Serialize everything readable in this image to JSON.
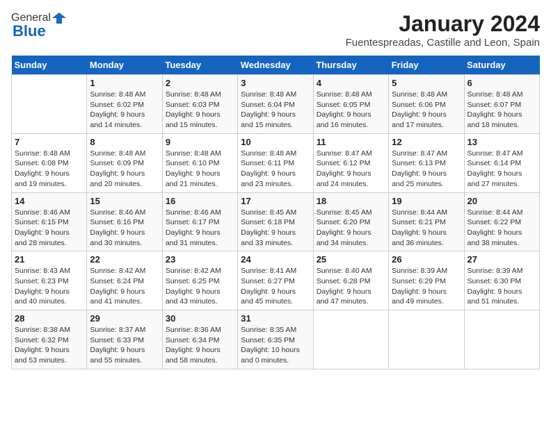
{
  "logo": {
    "general": "General",
    "blue": "Blue"
  },
  "title": "January 2024",
  "subtitle": "Fuentespreadas, Castille and Leon, Spain",
  "days_header": [
    "Sunday",
    "Monday",
    "Tuesday",
    "Wednesday",
    "Thursday",
    "Friday",
    "Saturday"
  ],
  "weeks": [
    [
      {
        "num": "",
        "info": ""
      },
      {
        "num": "1",
        "info": "Sunrise: 8:48 AM\nSunset: 6:02 PM\nDaylight: 9 hours\nand 14 minutes."
      },
      {
        "num": "2",
        "info": "Sunrise: 8:48 AM\nSunset: 6:03 PM\nDaylight: 9 hours\nand 15 minutes."
      },
      {
        "num": "3",
        "info": "Sunrise: 8:48 AM\nSunset: 6:04 PM\nDaylight: 9 hours\nand 15 minutes."
      },
      {
        "num": "4",
        "info": "Sunrise: 8:48 AM\nSunset: 6:05 PM\nDaylight: 9 hours\nand 16 minutes."
      },
      {
        "num": "5",
        "info": "Sunrise: 8:48 AM\nSunset: 6:06 PM\nDaylight: 9 hours\nand 17 minutes."
      },
      {
        "num": "6",
        "info": "Sunrise: 8:48 AM\nSunset: 6:07 PM\nDaylight: 9 hours\nand 18 minutes."
      }
    ],
    [
      {
        "num": "7",
        "info": "Sunrise: 8:48 AM\nSunset: 6:08 PM\nDaylight: 9 hours\nand 19 minutes."
      },
      {
        "num": "8",
        "info": "Sunrise: 8:48 AM\nSunset: 6:09 PM\nDaylight: 9 hours\nand 20 minutes."
      },
      {
        "num": "9",
        "info": "Sunrise: 8:48 AM\nSunset: 6:10 PM\nDaylight: 9 hours\nand 21 minutes."
      },
      {
        "num": "10",
        "info": "Sunrise: 8:48 AM\nSunset: 6:11 PM\nDaylight: 9 hours\nand 23 minutes."
      },
      {
        "num": "11",
        "info": "Sunrise: 8:47 AM\nSunset: 6:12 PM\nDaylight: 9 hours\nand 24 minutes."
      },
      {
        "num": "12",
        "info": "Sunrise: 8:47 AM\nSunset: 6:13 PM\nDaylight: 9 hours\nand 25 minutes."
      },
      {
        "num": "13",
        "info": "Sunrise: 8:47 AM\nSunset: 6:14 PM\nDaylight: 9 hours\nand 27 minutes."
      }
    ],
    [
      {
        "num": "14",
        "info": "Sunrise: 8:46 AM\nSunset: 6:15 PM\nDaylight: 9 hours\nand 28 minutes."
      },
      {
        "num": "15",
        "info": "Sunrise: 8:46 AM\nSunset: 6:16 PM\nDaylight: 9 hours\nand 30 minutes."
      },
      {
        "num": "16",
        "info": "Sunrise: 8:46 AM\nSunset: 6:17 PM\nDaylight: 9 hours\nand 31 minutes."
      },
      {
        "num": "17",
        "info": "Sunrise: 8:45 AM\nSunset: 6:18 PM\nDaylight: 9 hours\nand 33 minutes."
      },
      {
        "num": "18",
        "info": "Sunrise: 8:45 AM\nSunset: 6:20 PM\nDaylight: 9 hours\nand 34 minutes."
      },
      {
        "num": "19",
        "info": "Sunrise: 8:44 AM\nSunset: 6:21 PM\nDaylight: 9 hours\nand 36 minutes."
      },
      {
        "num": "20",
        "info": "Sunrise: 8:44 AM\nSunset: 6:22 PM\nDaylight: 9 hours\nand 38 minutes."
      }
    ],
    [
      {
        "num": "21",
        "info": "Sunrise: 8:43 AM\nSunset: 6:23 PM\nDaylight: 9 hours\nand 40 minutes."
      },
      {
        "num": "22",
        "info": "Sunrise: 8:42 AM\nSunset: 6:24 PM\nDaylight: 9 hours\nand 41 minutes."
      },
      {
        "num": "23",
        "info": "Sunrise: 8:42 AM\nSunset: 6:25 PM\nDaylight: 9 hours\nand 43 minutes."
      },
      {
        "num": "24",
        "info": "Sunrise: 8:41 AM\nSunset: 6:27 PM\nDaylight: 9 hours\nand 45 minutes."
      },
      {
        "num": "25",
        "info": "Sunrise: 8:40 AM\nSunset: 6:28 PM\nDaylight: 9 hours\nand 47 minutes."
      },
      {
        "num": "26",
        "info": "Sunrise: 8:39 AM\nSunset: 6:29 PM\nDaylight: 9 hours\nand 49 minutes."
      },
      {
        "num": "27",
        "info": "Sunrise: 8:39 AM\nSunset: 6:30 PM\nDaylight: 9 hours\nand 51 minutes."
      }
    ],
    [
      {
        "num": "28",
        "info": "Sunrise: 8:38 AM\nSunset: 6:32 PM\nDaylight: 9 hours\nand 53 minutes."
      },
      {
        "num": "29",
        "info": "Sunrise: 8:37 AM\nSunset: 6:33 PM\nDaylight: 9 hours\nand 55 minutes."
      },
      {
        "num": "30",
        "info": "Sunrise: 8:36 AM\nSunset: 6:34 PM\nDaylight: 9 hours\nand 58 minutes."
      },
      {
        "num": "31",
        "info": "Sunrise: 8:35 AM\nSunset: 6:35 PM\nDaylight: 10 hours\nand 0 minutes."
      },
      {
        "num": "",
        "info": ""
      },
      {
        "num": "",
        "info": ""
      },
      {
        "num": "",
        "info": ""
      }
    ]
  ]
}
